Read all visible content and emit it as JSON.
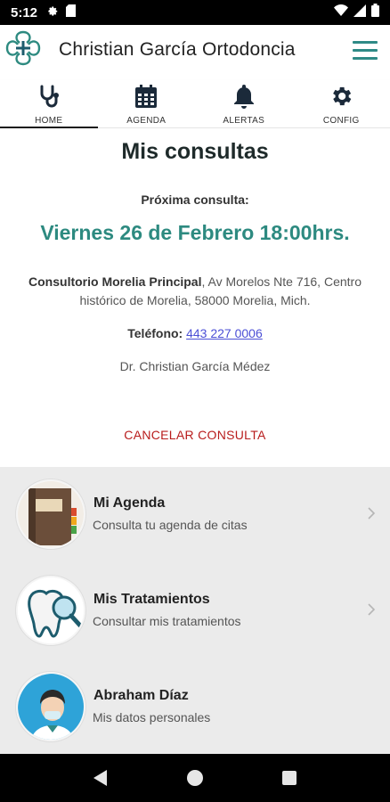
{
  "status_bar": {
    "time": "5:12"
  },
  "app_bar": {
    "title": "Christian García Ortodoncia"
  },
  "tabs": [
    {
      "label": "HOME",
      "icon": "stethoscope-icon",
      "active": true
    },
    {
      "label": "AGENDA",
      "icon": "calendar-icon",
      "active": false
    },
    {
      "label": "ALERTAS",
      "icon": "bell-icon",
      "active": false
    },
    {
      "label": "CONFIG",
      "icon": "gear-icon",
      "active": false
    }
  ],
  "main": {
    "title": "Mis consultas",
    "next_label": "Próxima consulta:",
    "next_date": "Viernes 26 de Febrero 18:00hrs.",
    "clinic_name": "Consultorio Morelia Principal",
    "clinic_address": ", Av Morelos Nte 716, Centro histórico de Morelia, 58000 Morelia, Mich.",
    "phone_label": "Teléfono:",
    "phone_number": "443 227 0006",
    "doctor": "Dr. Christian García Médez",
    "cancel_label": "CANCELAR CONSULTA"
  },
  "list": [
    {
      "title": "Mi Agenda",
      "subtitle": "Consulta tu agenda de citas",
      "icon": "agenda-book-icon",
      "chevron": true
    },
    {
      "title": "Mis Tratamientos",
      "subtitle": "Consultar mis tratamientos",
      "icon": "tooth-magnifier-icon",
      "chevron": true
    },
    {
      "title": "Abraham Díaz",
      "subtitle": "Mis datos personales",
      "icon": "doctor-avatar-icon",
      "chevron": false
    }
  ],
  "colors": {
    "accent": "#2d8a80",
    "cancel": "#b81c1c",
    "link": "#4b4fd6",
    "list_bg": "#ebebeb"
  }
}
